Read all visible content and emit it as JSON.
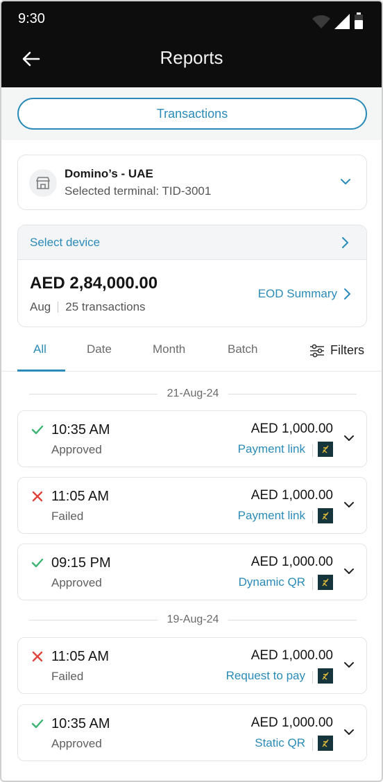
{
  "status_bar": {
    "time": "9:30"
  },
  "app_bar": {
    "title": "Reports"
  },
  "segment": {
    "label": "Transactions"
  },
  "merchant": {
    "name": "Domino’s -  UAE",
    "terminal": "Selected terminal: TID-3001"
  },
  "summary": {
    "select_device_label": "Select device",
    "total_amount": "AED 2,84,000.00",
    "period": "Aug",
    "transactions_count": "25 transactions",
    "eod_link": "EOD Summary"
  },
  "tabs": [
    {
      "label": "All",
      "active": true
    },
    {
      "label": "Date",
      "active": false
    },
    {
      "label": "Month",
      "active": false
    },
    {
      "label": "Batch",
      "active": false
    }
  ],
  "filters_label": "Filters",
  "groups": [
    {
      "date": "21-Aug-24",
      "transactions": [
        {
          "time": "10:35 AM",
          "status": "Approved",
          "amount": "AED 1,000.00",
          "method": "Payment link",
          "result": "success"
        },
        {
          "time": "11:05 AM",
          "status": "Failed",
          "amount": "AED 1,000.00",
          "method": "Payment link",
          "result": "failed"
        },
        {
          "time": "09:15 PM",
          "status": "Approved",
          "amount": "AED 1,000.00",
          "method": "Dynamic QR",
          "result": "success"
        }
      ]
    },
    {
      "date": "19-Aug-24",
      "transactions": [
        {
          "time": "11:05 AM",
          "status": "Failed",
          "amount": "AED 1,000.00",
          "method": "Request to pay",
          "result": "failed"
        },
        {
          "time": "10:35 AM",
          "status": "Approved",
          "amount": "AED 1,000.00",
          "method": "Static QR",
          "result": "success"
        }
      ]
    }
  ],
  "colors": {
    "accent": "#2a8bb8",
    "success": "#3cb371",
    "failed": "#e0433a",
    "app_bar": "#0d0d0d"
  },
  "icons": [
    "back-arrow-icon",
    "store-icon",
    "chevron-down-icon",
    "chevron-right-icon",
    "filter-sliders-icon",
    "check-icon",
    "cross-icon",
    "terminal-icon",
    "wifi-icon",
    "signal-icon",
    "battery-icon"
  ]
}
